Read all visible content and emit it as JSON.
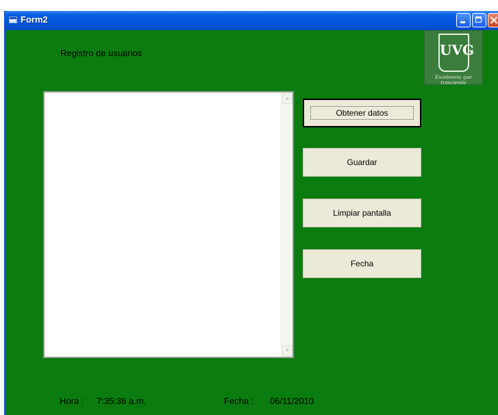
{
  "window": {
    "title": "Form2",
    "title_icon": "form-icon",
    "controls": {
      "minimize": "minimize-icon",
      "maximize": "maximize-icon",
      "close": "close-icon"
    }
  },
  "heading": "Registro de usuarios",
  "logo": {
    "initials": "UVG",
    "motto": "Excelencia que trasciende"
  },
  "buttons": {
    "get_data": "Obtener datos",
    "save": "Guardar",
    "clear": "Limpiar pantalla",
    "date": "Fecha"
  },
  "status": {
    "time_label": "Hora :",
    "time_value": "7:35:36 a.m.",
    "date_label": "Fecha :",
    "date_value": "06/11/2010"
  },
  "textarea": {
    "value": ""
  },
  "colors": {
    "form_background": "#0b7d10",
    "title_bar": "#0457dc",
    "button_face": "#ece9d8"
  }
}
